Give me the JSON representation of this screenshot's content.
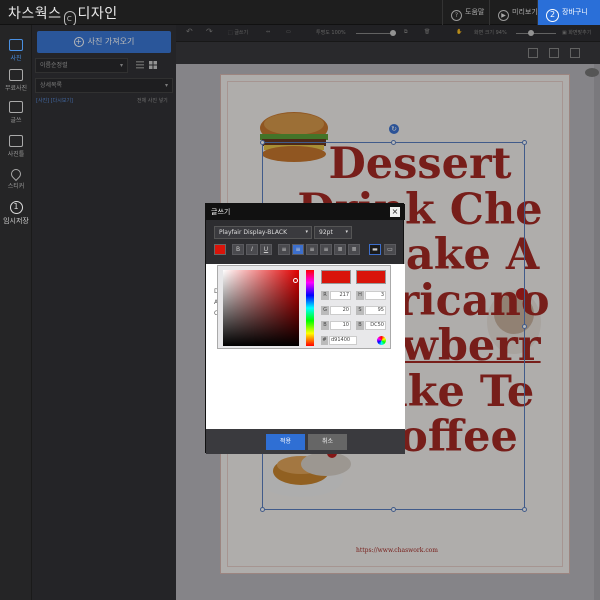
{
  "app": {
    "brand_left": "차스웍스",
    "brand_logo": "C",
    "brand_right": "디자인"
  },
  "topbar": {
    "guide_label": "도움말",
    "preview_label": "미리보기",
    "cart_number": "2",
    "cart_label": "장바구니 담기"
  },
  "iconbar": {
    "items": [
      {
        "label": "사진"
      },
      {
        "label": "무료사진"
      },
      {
        "label": "글쓰"
      },
      {
        "label": "사진틀"
      },
      {
        "label": "스티커"
      },
      {
        "label": "임시저장",
        "num": "1"
      }
    ]
  },
  "sidepanel": {
    "add_photo": "사진 가져오기",
    "sort_select": "이름순정렬",
    "category_select": "상세목록",
    "link_left": "[사진] [다시보기]",
    "link_right": "전체 사진 넣기"
  },
  "toolbar": {
    "text_label": "글쓰기",
    "opacity_label": "투명도 100%",
    "zoom_label": "화면 크기 94%",
    "fullscreen_label": "화면맞추기"
  },
  "canvas": {
    "headline": [
      "Dessert",
      "Drink Che",
      "esecake A",
      "Americano",
      "Strawberr",
      "y Cake Te",
      "a Coffee"
    ],
    "url": "https://www.chaswork.com"
  },
  "dialog": {
    "title": "글쓰기",
    "close": "×",
    "font": "Playfair Display-BLACK",
    "size": "92pt",
    "bold": "B",
    "italic": "I",
    "underline": "U",
    "text_preview": [
      "D",
      "A",
      "C"
    ],
    "ok": "적용",
    "cancel": "취소"
  },
  "colorpicker": {
    "r": "217",
    "h": "3",
    "g": "20",
    "s": "95",
    "b": "10",
    "l": "DC50",
    "hex": "d91400",
    "color": "#d9140a"
  }
}
